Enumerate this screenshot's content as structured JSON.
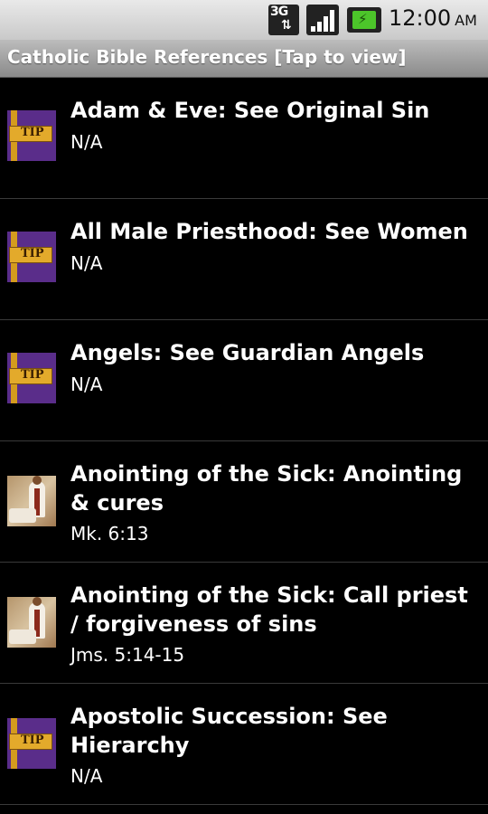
{
  "status_bar": {
    "network_type": "3G",
    "time": "12:00",
    "ampm": "AM",
    "icons": [
      "3g-data-icon",
      "signal-icon",
      "battery-charging-icon"
    ],
    "signal_level": 1.0,
    "battery_color": "#4cc52a"
  },
  "title_bar": {
    "title": "Catholic Bible References  [Tap to view]"
  },
  "list": {
    "items": [
      {
        "title": "Adam & Eve: See Original Sin",
        "reference": "N/A",
        "icon": "tip-sign-icon"
      },
      {
        "title": "All Male Priesthood: See Women",
        "reference": "N/A",
        "icon": "tip-sign-icon"
      },
      {
        "title": "Angels: See Guardian Angels",
        "reference": "N/A",
        "icon": "tip-sign-icon"
      },
      {
        "title": "Anointing of the Sick: Anointing & cures",
        "reference": "Mk. 6:13",
        "icon": "priest-photo-icon"
      },
      {
        "title": "Anointing of the Sick: Call priest / forgiveness of sins",
        "reference": "Jms. 5:14-15",
        "icon": "priest-photo-icon"
      },
      {
        "title": "Apostolic Succession: See Hierarchy",
        "reference": "N/A",
        "icon": "tip-sign-icon"
      }
    ]
  },
  "tip_label": "TIP"
}
